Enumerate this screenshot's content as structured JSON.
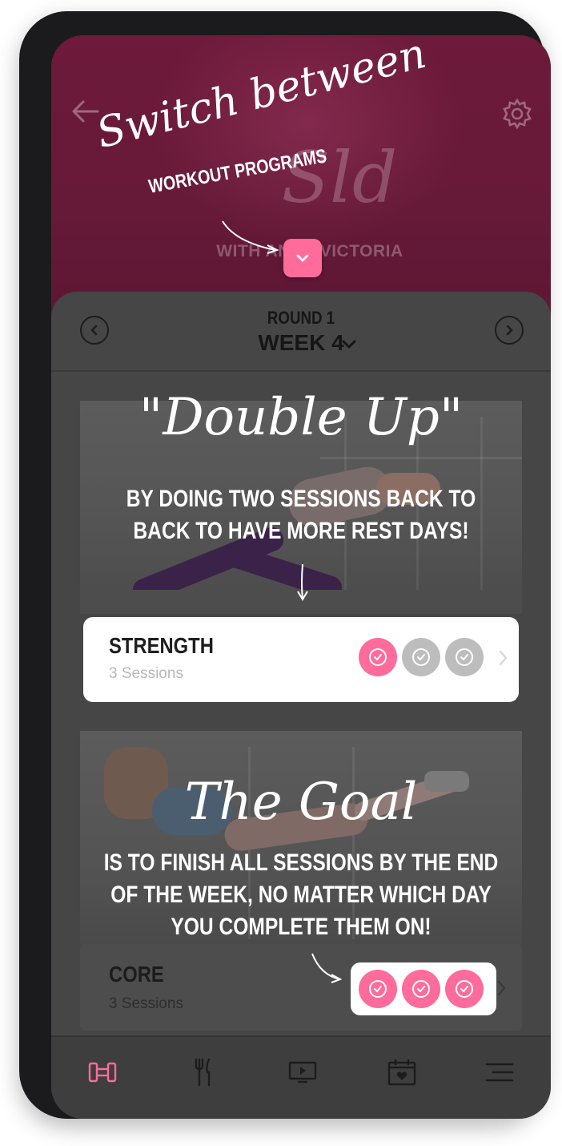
{
  "header": {
    "logo_script": "Sld",
    "logo_subtitle": "WITH ANNA VICTORIA"
  },
  "week_nav": {
    "round": "ROUND 1",
    "week": "WEEK 4"
  },
  "sessions": [
    {
      "title": "STRENGTH",
      "subtitle": "3 Sessions",
      "completed": 1,
      "total": 3
    },
    {
      "title": "CORE",
      "subtitle": "3 Sessions",
      "completed": 3,
      "total": 3
    }
  ],
  "annotations": {
    "switch_script": "Switch between",
    "switch_caps": "WORKOUT PROGRAMS",
    "double_script": "\"Double Up\"",
    "double_caps_line1": "BY DOING TWO SESSIONS BACK TO",
    "double_caps_line2": "BACK TO HAVE MORE REST DAYS!",
    "goal_script": "The Goal",
    "goal_caps_line1": "IS TO FINISH ALL SESSIONS BY THE END",
    "goal_caps_line2": "OF THE WEEK, NO MATTER WHICH DAY",
    "goal_caps_line3": "YOU COMPLETE THEM ON!"
  },
  "bottom_nav": [
    {
      "icon": "dumbbell-icon",
      "active": true
    },
    {
      "icon": "fork-knife-icon",
      "active": false
    },
    {
      "icon": "video-play-icon",
      "active": false
    },
    {
      "icon": "calendar-heart-icon",
      "active": false
    },
    {
      "icon": "menu-icon",
      "active": false
    }
  ],
  "colors": {
    "accent_pink": "#ff6b9a",
    "inactive_gray": "#bdbdbd",
    "header_maroon": "#6e1a3a"
  }
}
